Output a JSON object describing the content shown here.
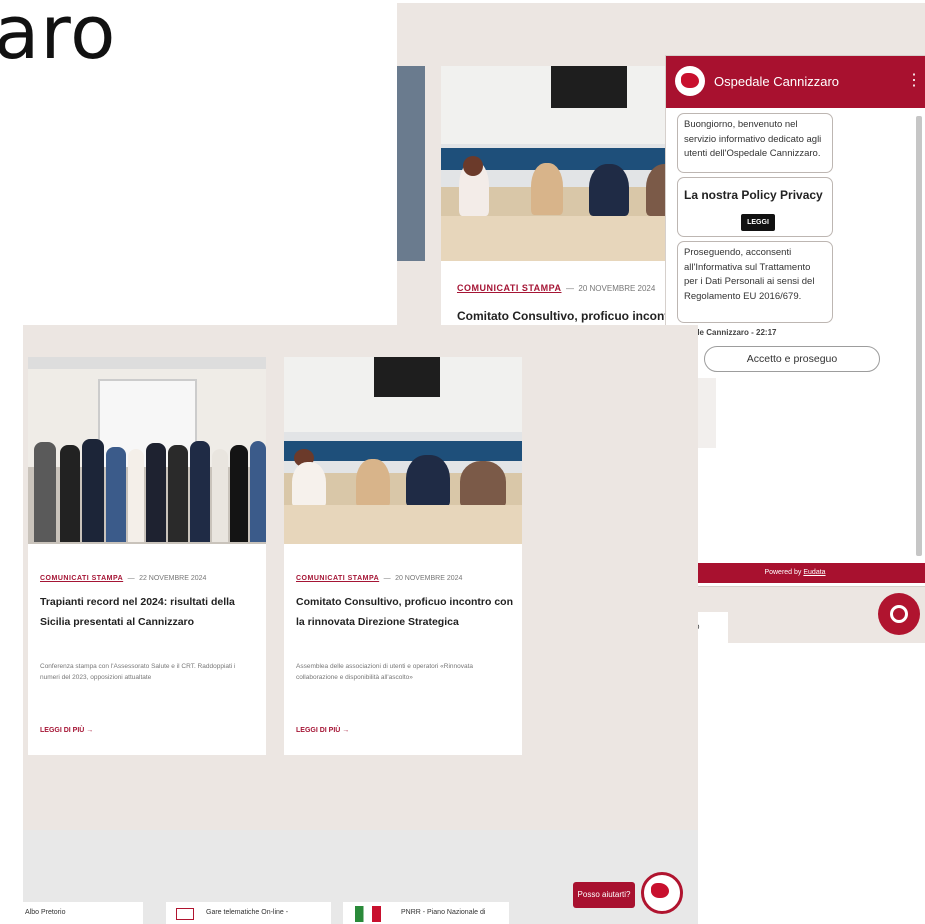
{
  "header_fragment": {
    "text": "aro"
  },
  "back_card": {
    "category": "COMUNICATI STAMPA",
    "separator": "—",
    "date": "20 NOVEMBRE 2024",
    "title": "Comitato Consultivo, proficuo incontro c"
  },
  "chat": {
    "title": "Ospedale Cannizzaro",
    "menu_icon": "more-vertical-icon",
    "welcome": "Buongiorno, benvenuto nel servizio informativo dedicato agli utenti dell'Ospedale Cannizzaro.",
    "policy_heading": "La nostra Policy Privacy",
    "policy_button": "LEGGI",
    "consent": "Proseguendo, acconsenti all'Informativa sul Trattamento per i Dati Personali ai sensi del Regolamento EU 2016/679.",
    "meta": "dale Cannizzaro - 22:17",
    "accept": "Accetto e proseguo",
    "footer_prefix": "Powered by",
    "footer_brand": "Eudata",
    "tab_fragment": "o"
  },
  "cards": [
    {
      "category": "COMUNICATI STAMPA",
      "separator": "—",
      "date": "22 NOVEMBRE 2024",
      "title": "Trapianti record nel 2024: risultati della Sicilia presentati al Cannizzaro",
      "description": "Conferenza stampa con l'Assessorato Salute e il CRT. Raddoppiati i numeri del 2023, opposizioni attualtate",
      "more": "LEGGI DI PIÙ →"
    },
    {
      "category": "COMUNICATI STAMPA",
      "separator": "—",
      "date": "20 NOVEMBRE 2024",
      "title": "Comitato Consultivo, proficuo incontro con la rinnovata Direzione Strategica",
      "description": "Assemblea delle associazioni di utenti e operatori «Rinnovata collaborazione e disponibilità all'ascolto»",
      "more": "LEGGI DI PIÙ →"
    }
  ],
  "footer_links": [
    {
      "label": "Albo Pretorio"
    },
    {
      "label": "Gare telematiche On-line -"
    },
    {
      "label": "PNRR - Piano Nazionale di"
    }
  ],
  "help_button": "Posso aiutarti?",
  "colors": {
    "brand": "#a8112f",
    "background": "#ece6e2"
  }
}
